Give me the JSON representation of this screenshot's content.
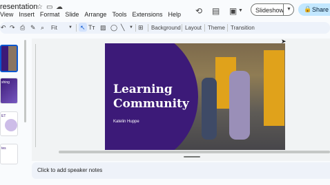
{
  "app": {
    "doc_title": "resentation",
    "menu": [
      "View",
      "Insert",
      "Format",
      "Slide",
      "Arrange",
      "Tools",
      "Extensions",
      "Help"
    ],
    "slideshow_label": "Slideshow",
    "share_label": "Share"
  },
  "toolbar": {
    "zoom_label": "Fit",
    "background_label": "Background",
    "layout_label": "Layout",
    "theme_label": "Theme",
    "transition_label": "Transition"
  },
  "filmstrip": {
    "thumbs": [
      {
        "text": "",
        "selected": true
      },
      {
        "text": "shing",
        "selected": false
      },
      {
        "text": "ET",
        "selected": false
      },
      {
        "text": "tes",
        "selected": false
      }
    ]
  },
  "slide": {
    "title_line1": "Learning",
    "title_line2": "Community",
    "author": "Katelin Huppe"
  },
  "notes": {
    "placeholder": "Click to add speaker notes"
  },
  "colors": {
    "slide_purple": "#3c1a78",
    "share_bg": "#c2e7ff",
    "selected_thumb_border": "#0b57d0"
  }
}
